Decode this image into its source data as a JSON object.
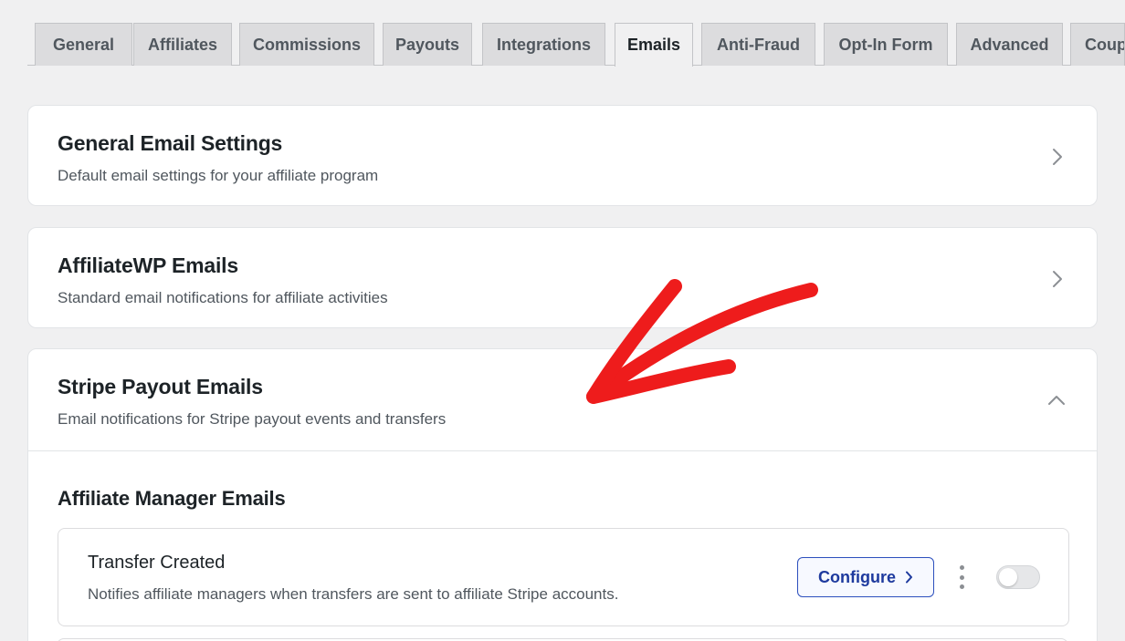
{
  "tabs": [
    {
      "label": "General",
      "active": false
    },
    {
      "label": "Affiliates",
      "active": false
    },
    {
      "label": "Commissions",
      "active": false
    },
    {
      "label": "Payouts",
      "active": false
    },
    {
      "label": "Integrations",
      "active": false
    },
    {
      "label": "Emails",
      "active": true
    },
    {
      "label": "Anti-Fraud",
      "active": false
    },
    {
      "label": "Opt-In Form",
      "active": false
    },
    {
      "label": "Advanced",
      "active": false
    },
    {
      "label": "Coup",
      "active": false
    }
  ],
  "sections": [
    {
      "title": "General Email Settings",
      "description": "Default email settings for your affiliate program",
      "icon": "chevron-right-icon",
      "expanded": false
    },
    {
      "title": "AffiliateWP Emails",
      "description": "Standard email notifications for affiliate activities",
      "icon": "chevron-right-icon",
      "expanded": false
    },
    {
      "title": "Stripe Payout Emails",
      "description": "Email notifications for Stripe payout events and transfers",
      "icon": "chevron-up-icon",
      "expanded": true
    }
  ],
  "stripe_section": {
    "group_title": "Affiliate Manager Emails",
    "emails": [
      {
        "title": "Transfer Created",
        "description": "Notifies affiliate managers when transfers are sent to affiliate Stripe accounts.",
        "configure_label": "Configure",
        "enabled": false
      }
    ]
  },
  "annotation": {
    "icon": "red-arrow-icon",
    "color": "#ee1c1c"
  },
  "colors": {
    "background": "#f0f0f1",
    "tab_inactive": "#dcdcde",
    "card": "#ffffff",
    "accent": "#2c4fbd"
  }
}
